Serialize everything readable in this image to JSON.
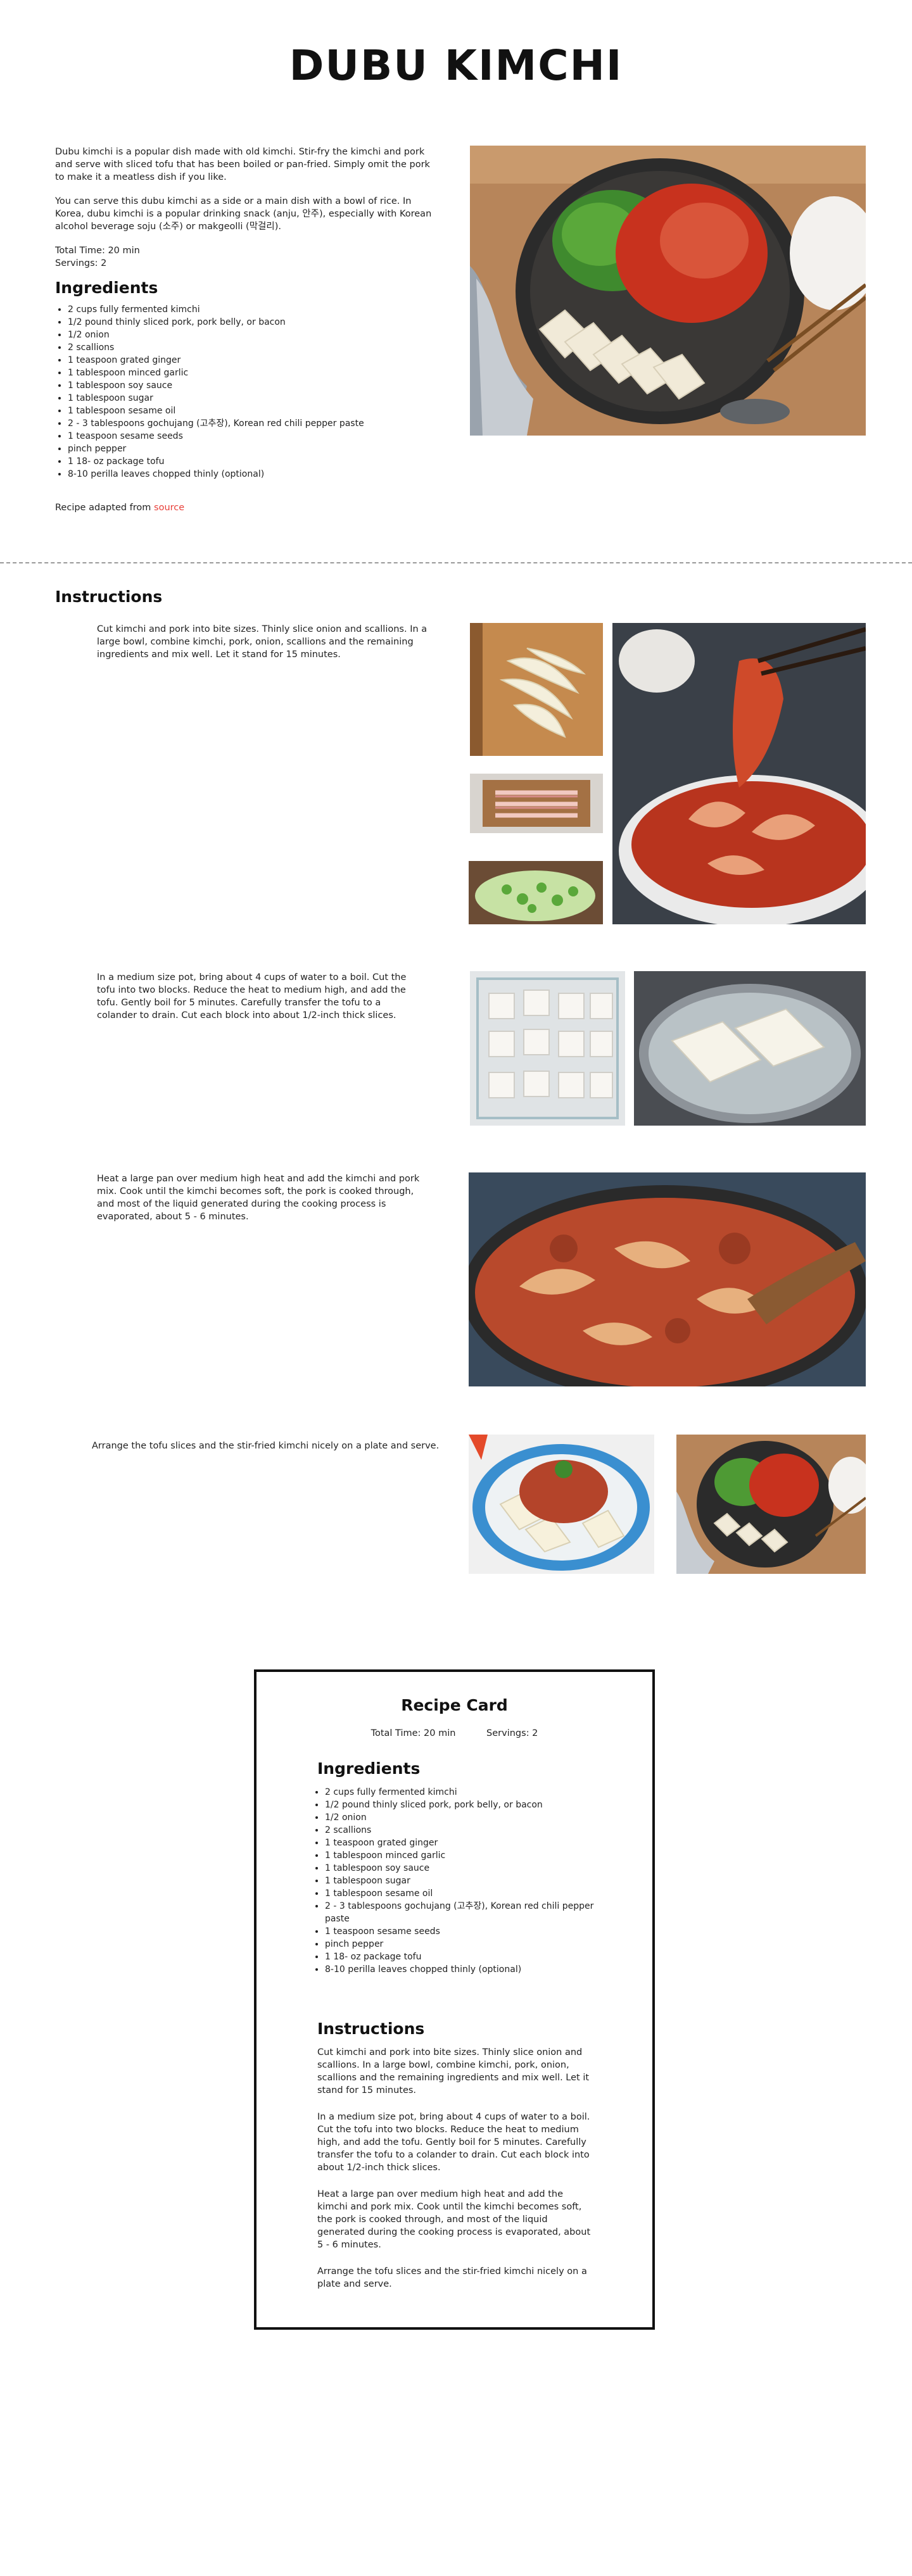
{
  "title": "DUBU KIMCHI",
  "intro": {
    "p1": "Dubu kimchi is a popular dish made with old kimchi. Stir-fry the kimchi and pork and serve with sliced tofu that has been boiled or pan-fried. Simply omit the pork to make it a meatless dish if you like.",
    "p2": "You can serve this dubu kimchi as a side or a main dish with a bowl of rice. In Korea, dubu kimchi is a popular drinking snack (anju, 안주), especially with Korean alcohol beverage soju (소주) or makgeolli (막걸리).",
    "total_time": "Total Time: 20 min",
    "servings": "Servings: 2"
  },
  "ingredients_heading": "Ingredients",
  "ingredients": [
    "2 cups fully fermented kimchi",
    "1/2 pound thinly sliced pork, pork belly, or bacon",
    "1/2 onion",
    "2 scallions",
    "1 teaspoon grated ginger",
    "1 tablespoon minced garlic",
    "1 tablespoon soy sauce",
    "1 tablespoon sugar",
    "1 tablespoon sesame oil",
    "2 - 3 tablespoons gochujang (고추장), Korean red chili pepper paste",
    "1 teaspoon sesame seeds",
    "pinch pepper",
    "1 18- oz package tofu",
    "8-10 perilla leaves chopped thinly (optional)"
  ],
  "adapted": {
    "prefix": "Recipe adapted from ",
    "link": "source"
  },
  "instructions_heading": "Instructions",
  "steps": [
    "Cut kimchi and pork into bite sizes. Thinly slice onion and scallions. In a large bowl, combine kimchi, pork, onion, scallions and the remaining ingredients and mix well. Let it stand for 15 minutes.",
    "In a medium size pot, bring about 4 cups of water to a boil. Cut the tofu into two blocks. Reduce the heat to medium high, and add the tofu. Gently boil for 5 minutes. Carefully transfer the tofu to a colander to drain. Cut each block into about 1/2-inch thick slices.",
    "Heat a large pan over medium high heat and add the kimchi and pork mix. Cook until the kimchi becomes soft, the pork is cooked through, and most of the liquid generated during the cooking process is evaporated, about 5 - 6 minutes.",
    "Arrange the tofu slices and the stir-fried kimchi nicely on a plate and serve."
  ],
  "card": {
    "title": "Recipe Card",
    "total_time": "Total Time: 20 min",
    "servings": "Servings: 2",
    "ingredients_heading": "Ingredients",
    "ingredients": [
      "2 cups fully fermented kimchi",
      "1/2 pound thinly sliced pork, pork belly, or bacon",
      "1/2 onion",
      "2 scallions",
      "1 teaspoon grated ginger",
      "1 tablespoon minced garlic",
      "1 tablespoon soy sauce",
      "1 tablespoon sugar",
      "1 tablespoon sesame oil",
      "2 - 3 tablespoons gochujang (고추장), Korean red chili pepper paste",
      "1 teaspoon sesame seeds",
      "pinch pepper",
      "1 18- oz package tofu",
      "8-10 perilla leaves chopped thinly (optional)"
    ],
    "instructions_heading": "Instructions",
    "steps": [
      "Cut kimchi and pork into bite sizes. Thinly slice onion and scallions. In a large bowl, combine kimchi, pork, onion, scallions and the remaining ingredients and mix well. Let it stand for 15 minutes.",
      "In a medium size pot, bring about 4 cups of water to a boil. Cut the tofu into two blocks. Reduce the heat to medium high, and add the tofu. Gently boil for 5 minutes. Carefully transfer the tofu to a colander to drain. Cut each block into about 1/2-inch thick slices.",
      "Heat a large pan over medium high heat and add the kimchi and pork mix. Cook until the kimchi becomes soft, the pork is cooked through, and most of the liquid generated during the cooking process is evaporated, about 5 - 6 minutes.",
      "Arrange the tofu slices and the stir-fried kimchi nicely on a plate and serve."
    ]
  },
  "colors": {
    "link": "#e8403a",
    "kimchi_red": "#c8321e",
    "tofu": "#f1ead8",
    "herb_green": "#3f8a2e"
  }
}
